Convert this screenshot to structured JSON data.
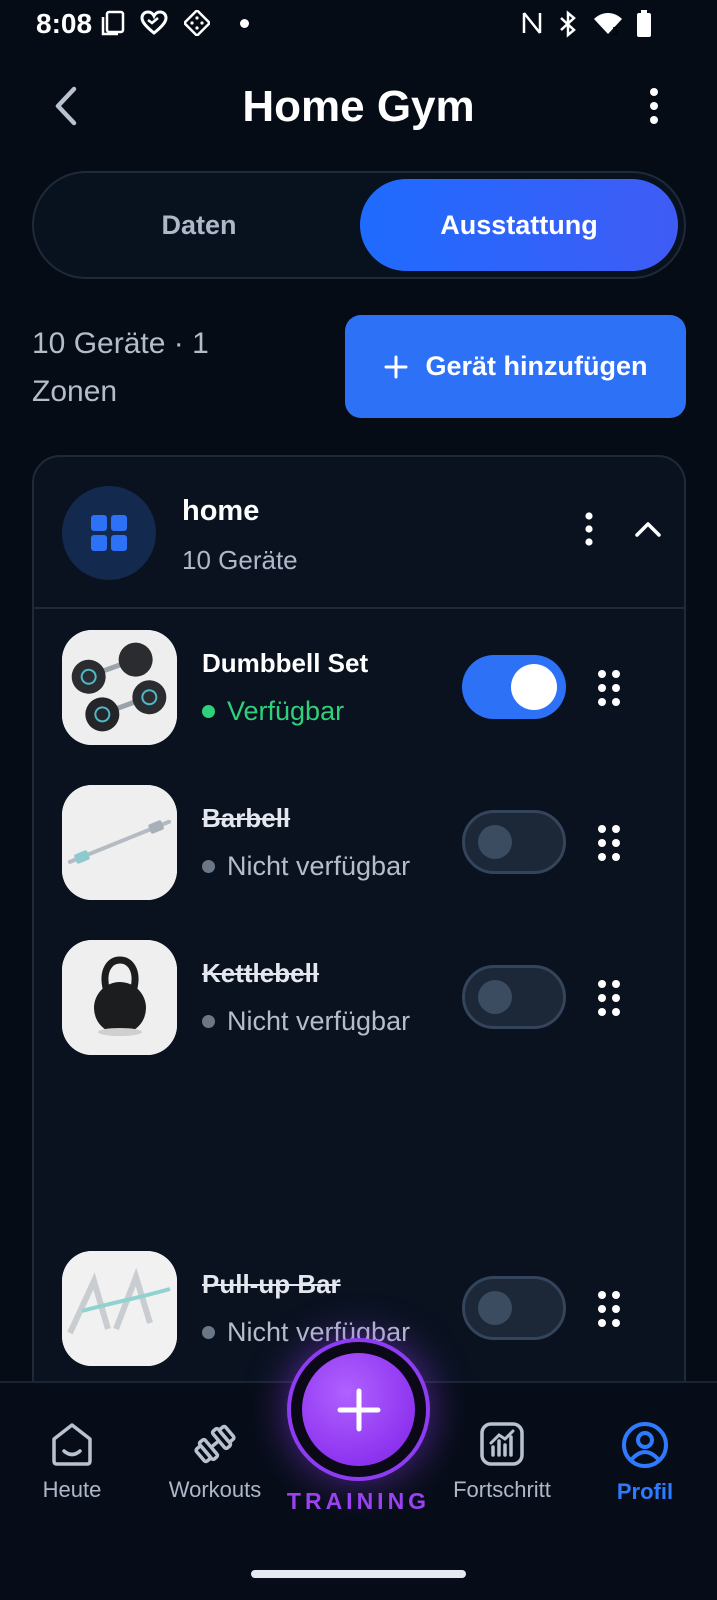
{
  "status_bar": {
    "time": "8:08",
    "left_icons": [
      "screenshot-icon",
      "heart-app-icon",
      "dice-app-icon",
      "notification-dot-icon"
    ],
    "right_icons": [
      "nfc-icon",
      "bluetooth-icon",
      "wifi-icon",
      "battery-icon"
    ]
  },
  "header": {
    "title": "Home Gym",
    "back_icon": "chevron-left-icon",
    "more_icon": "more-vertical-icon"
  },
  "tabs": [
    {
      "label": "Daten",
      "active": false
    },
    {
      "label": "Ausstattung",
      "active": true
    }
  ],
  "summary": {
    "text": "10 Geräte · 1 Zonen"
  },
  "add_button": {
    "label": "Gerät hinzufügen",
    "icon": "plus-icon"
  },
  "zone": {
    "name": "home",
    "count": "10 Geräte",
    "icon": "grid-icon",
    "expanded": true,
    "items": [
      {
        "name": "Dumbbell Set",
        "status": "Verfügbar",
        "available": true,
        "status_color": "#2fd07a",
        "thumbnail": "dumbbells-image"
      },
      {
        "name": "Barbell",
        "status": "Nicht verfügbar",
        "available": false,
        "status_color": "#6b7686",
        "thumbnail": "barbell-image"
      },
      {
        "name": "Kettlebell",
        "status": "Nicht verfügbar",
        "available": false,
        "status_color": "#6b7686",
        "thumbnail": "kettlebell-image"
      },
      {
        "name": "Pull-up Bar",
        "status": "Nicht verfügbar",
        "available": false,
        "status_color": "#6b7686",
        "thumbnail": "pullup-bar-image"
      }
    ]
  },
  "nav": {
    "items": [
      {
        "label": "Heute",
        "icon": "home-icon",
        "active": false
      },
      {
        "label": "Workouts",
        "icon": "dumbbell-icon",
        "active": false
      },
      {
        "label": "Fortschritt",
        "icon": "chart-icon",
        "active": false
      },
      {
        "label": "Profil",
        "icon": "profile-icon",
        "active": true
      }
    ],
    "fab": {
      "label": "TRAINING",
      "icon": "plus-icon"
    }
  },
  "colors": {
    "background": "#060c16",
    "accent": "#2d71f7",
    "fab": "#9a42f2",
    "available": "#2fd07a"
  }
}
